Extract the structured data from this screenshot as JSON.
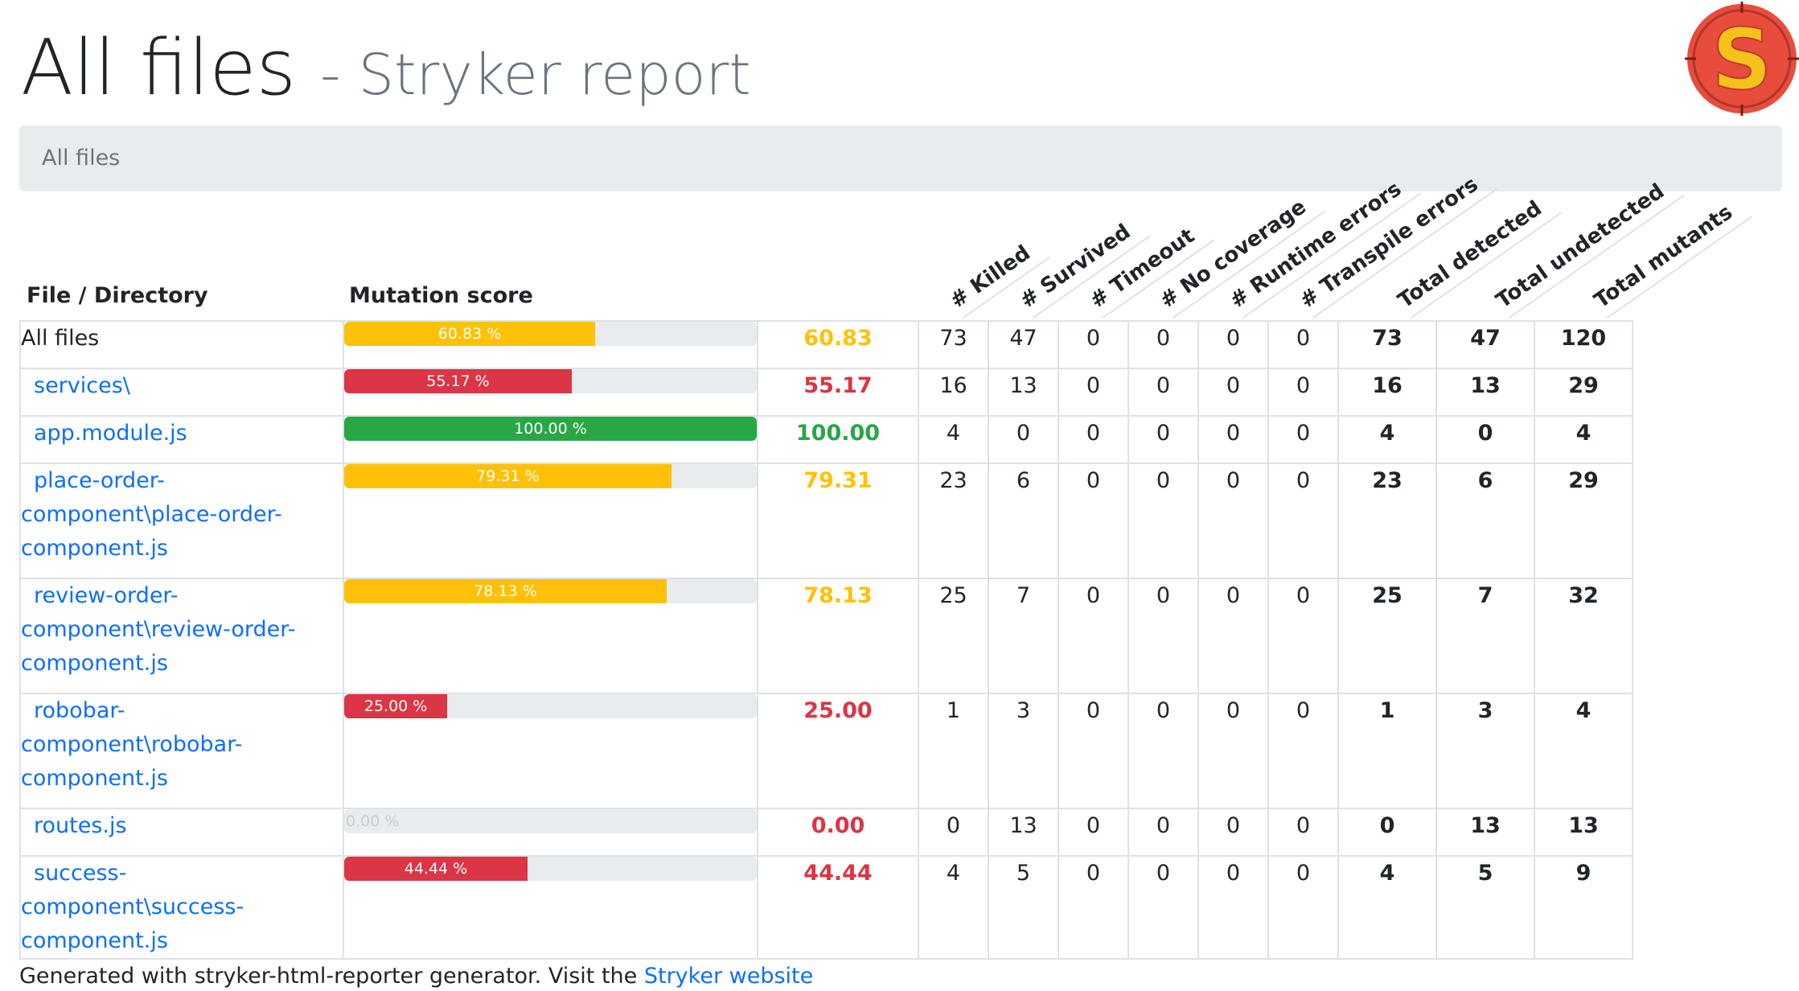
{
  "title": {
    "main": "All files",
    "sub": "- Stryker report"
  },
  "breadcrumb": "All files",
  "columns": {
    "file": "File / Directory",
    "score": "Mutation score",
    "rotated": [
      "# Killed",
      "# Survived",
      "# Timeout",
      "# No coverage",
      "# Runtime errors",
      "# Transpile errors",
      "Total detected",
      "Total undetected",
      "Total mutants"
    ]
  },
  "rows": [
    {
      "name": "All files",
      "link": false,
      "score": 60.83,
      "score_text": "60.83",
      "pct_text": "60.83 %",
      "status": "warning",
      "killed": "73",
      "survived": "47",
      "timeout": "0",
      "no_coverage": "0",
      "runtime_errors": "0",
      "transpile_errors": "0",
      "total_detected": "73",
      "total_undetected": "47",
      "total_mutants": "120"
    },
    {
      "name": "services\\",
      "link": true,
      "score": 55.17,
      "score_text": "55.17",
      "pct_text": "55.17 %",
      "status": "danger",
      "killed": "16",
      "survived": "13",
      "timeout": "0",
      "no_coverage": "0",
      "runtime_errors": "0",
      "transpile_errors": "0",
      "total_detected": "16",
      "total_undetected": "13",
      "total_mutants": "29"
    },
    {
      "name": "app.module.js",
      "link": true,
      "score": 100.0,
      "score_text": "100.00",
      "pct_text": "100.00 %",
      "status": "success",
      "killed": "4",
      "survived": "0",
      "timeout": "0",
      "no_coverage": "0",
      "runtime_errors": "0",
      "transpile_errors": "0",
      "total_detected": "4",
      "total_undetected": "0",
      "total_mutants": "4"
    },
    {
      "name": "place-order-component\\place-order-component.js",
      "link": true,
      "score": 79.31,
      "score_text": "79.31",
      "pct_text": "79.31 %",
      "status": "warning",
      "killed": "23",
      "survived": "6",
      "timeout": "0",
      "no_coverage": "0",
      "runtime_errors": "0",
      "transpile_errors": "0",
      "total_detected": "23",
      "total_undetected": "6",
      "total_mutants": "29"
    },
    {
      "name": "review-order-component\\review-order-component.js",
      "link": true,
      "score": 78.13,
      "score_text": "78.13",
      "pct_text": "78.13 %",
      "status": "warning",
      "killed": "25",
      "survived": "7",
      "timeout": "0",
      "no_coverage": "0",
      "runtime_errors": "0",
      "transpile_errors": "0",
      "total_detected": "25",
      "total_undetected": "7",
      "total_mutants": "32"
    },
    {
      "name": "robobar-component\\robobar-component.js",
      "link": true,
      "score": 25.0,
      "score_text": "25.00",
      "pct_text": "25.00 %",
      "status": "danger",
      "killed": "1",
      "survived": "3",
      "timeout": "0",
      "no_coverage": "0",
      "runtime_errors": "0",
      "transpile_errors": "0",
      "total_detected": "1",
      "total_undetected": "3",
      "total_mutants": "4"
    },
    {
      "name": "routes.js",
      "link": true,
      "score": 0.0,
      "score_text": "0.00",
      "pct_text": "0.00 %",
      "status": "danger",
      "killed": "0",
      "survived": "13",
      "timeout": "0",
      "no_coverage": "0",
      "runtime_errors": "0",
      "transpile_errors": "0",
      "total_detected": "0",
      "total_undetected": "13",
      "total_mutants": "13"
    },
    {
      "name": "success-component\\success-component.js",
      "link": true,
      "score": 44.44,
      "score_text": "44.44",
      "pct_text": "44.44 %",
      "status": "danger",
      "killed": "4",
      "survived": "5",
      "timeout": "0",
      "no_coverage": "0",
      "runtime_errors": "0",
      "transpile_errors": "0",
      "total_detected": "4",
      "total_undetected": "5",
      "total_mutants": "9"
    }
  ],
  "footer": {
    "text": "Generated with stryker-html-reporter generator. Visit the",
    "link": "Stryker website"
  },
  "logo": {
    "icon": "stryker-logo-icon",
    "letter": "S",
    "colors": {
      "ring": "#e74c3c",
      "letter": "#f4c21a"
    }
  }
}
